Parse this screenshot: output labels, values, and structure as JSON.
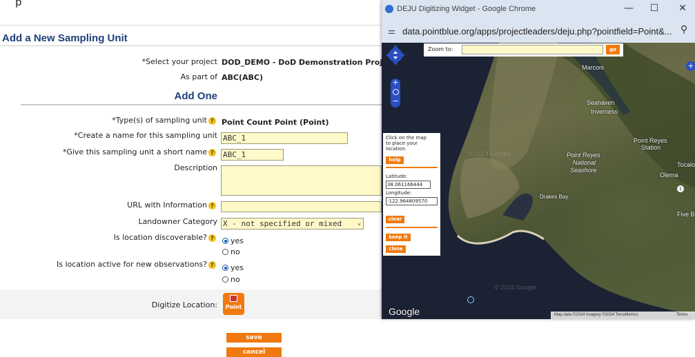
{
  "page": {
    "top_partial_text": "p",
    "title": "Add a New Sampling Unit",
    "project_label": "*Select your project",
    "project_value": "DOD_DEMO - DoD Demonstration Proje",
    "part_of_label": "As part of",
    "part_of_value": "ABC(ABC)",
    "section_title": "Add One"
  },
  "form": {
    "type_label": "*Type(s) of sampling unit",
    "type_value": "Point Count Point (Point)",
    "name_label": "*Create a name for this sampling unit",
    "name_value": "ABC_1",
    "short_name_label": "*Give this sampling unit a short name",
    "short_name_value": "ABC_1",
    "description_label": "Description",
    "description_value": "",
    "url_label": "URL with Information",
    "url_value": "",
    "landowner_label": "Landowner Category",
    "landowner_value": "X - not specified or mixed",
    "discoverable_label": "Is location discoverable?",
    "active_label": "Is location active for new observations?",
    "opt_yes": "yes",
    "opt_no": "no",
    "digitize_label": "Digitize Location:",
    "point_button": "Point",
    "save_button": "save",
    "cancel_button": "cancel",
    "help_glyph": "?"
  },
  "popup": {
    "window_title": "DEJU Digitizing Widget - Google Chrome",
    "minimize": "—",
    "maximize": "☐",
    "close": "✕",
    "address": "data.pointblue.org/apps/projectleaders/deju.php?pointfield=Point&...",
    "zoom_label": "Zoom to:",
    "zoom_value": "",
    "go_button": "go",
    "side": {
      "instruction": "Click on the map to place your location.",
      "help_button": "help",
      "latitude_label": "Latitude:",
      "latitude_value": "38.061166444",
      "longitude_label": "Longitude:",
      "longitude_value": "-122.964809570",
      "clear_button": "clear",
      "keep_button": "keep it",
      "close_button": "close"
    },
    "map_labels": {
      "marconi": "Marconi",
      "seahaven": "Seahaven",
      "inverness": "Inverness",
      "point_reyes_station_1": "Point Reyes",
      "point_reyes_station_2": "Station",
      "prns_1": "Point Reyes",
      "prns_2": "National",
      "prns_3": "Seashore",
      "tocalo": "Tocalo",
      "olema": "Olema",
      "drakes_bay": "Drakes Bay",
      "five_br": "Five Br",
      "watermark_1": "© 2024 Google",
      "watermark_2": "© 2024 Google",
      "route_badge": "1"
    },
    "google_logo": "Google",
    "attribution": "Map data ©2024 Imagery ©2024 TerraMetrics",
    "terms": "Terms"
  },
  "colors": {
    "accent_orange": "#f07a10",
    "title_blue": "#1f3f7a",
    "field_yellow": "#fff8c8"
  }
}
